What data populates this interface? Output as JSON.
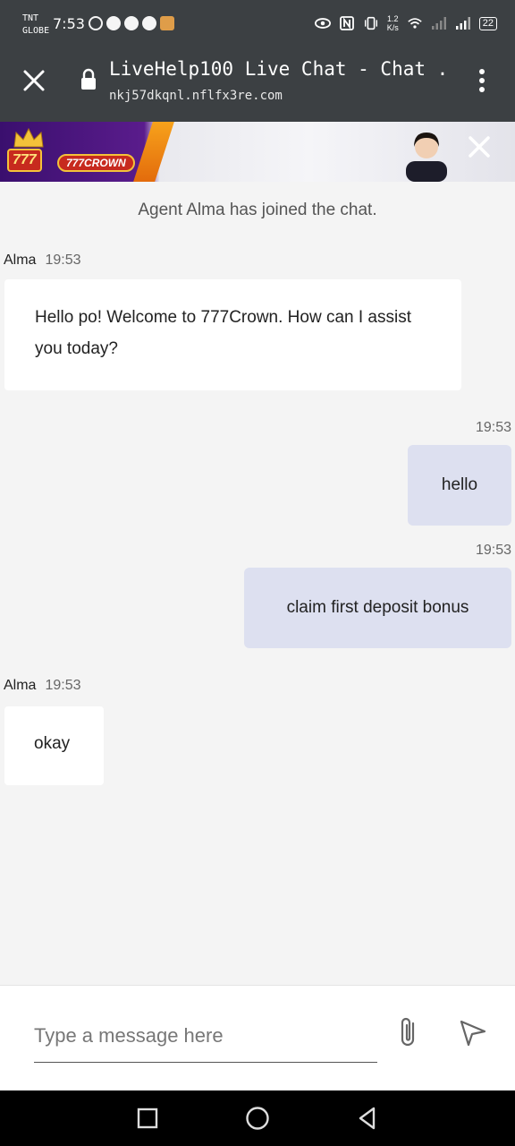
{
  "status_bar": {
    "carrier_line1": "TNT",
    "carrier_line2": "GLOBE",
    "time": "7:53",
    "net_speed_value": "1.2",
    "net_speed_unit": "K/s",
    "battery": "22"
  },
  "browser": {
    "title": "LiveHelp100 Live Chat - Chat ...",
    "url": "nkj57dkqnl.nflfx3re.com",
    "close_icon": "close-icon",
    "lock_icon": "lock-icon",
    "menu_icon": "more-vert-icon"
  },
  "banner": {
    "logo_number": "777",
    "logo_name": "777CROWN",
    "colors": {
      "purple": "#3a0f6e",
      "red": "#c72a1e",
      "gold": "#f3c23a"
    }
  },
  "chat": {
    "system_message": "Agent Alma has joined the chat.",
    "messages": [
      {
        "direction": "in",
        "sender": "Alma",
        "time": "19:53",
        "text": "Hello po! Welcome to 777Crown. How can I assist you today?"
      },
      {
        "direction": "out",
        "time": "19:53",
        "text": "hello"
      },
      {
        "direction": "out",
        "time": "19:53",
        "text": "claim first deposit bonus"
      },
      {
        "direction": "in",
        "sender": "Alma",
        "time": "19:53",
        "text": "okay"
      }
    ]
  },
  "composer": {
    "placeholder": "Type a message here",
    "attach_icon": "paperclip-icon",
    "send_icon": "send-icon"
  },
  "navbar": {
    "recents_icon": "square-icon",
    "home_icon": "circle-icon",
    "back_icon": "triangle-back-icon"
  },
  "colors": {
    "header_bg": "#3c4043",
    "chat_bg": "#f4f4f4",
    "outgoing_bubble": "#dde0f0",
    "incoming_bubble": "#ffffff"
  }
}
